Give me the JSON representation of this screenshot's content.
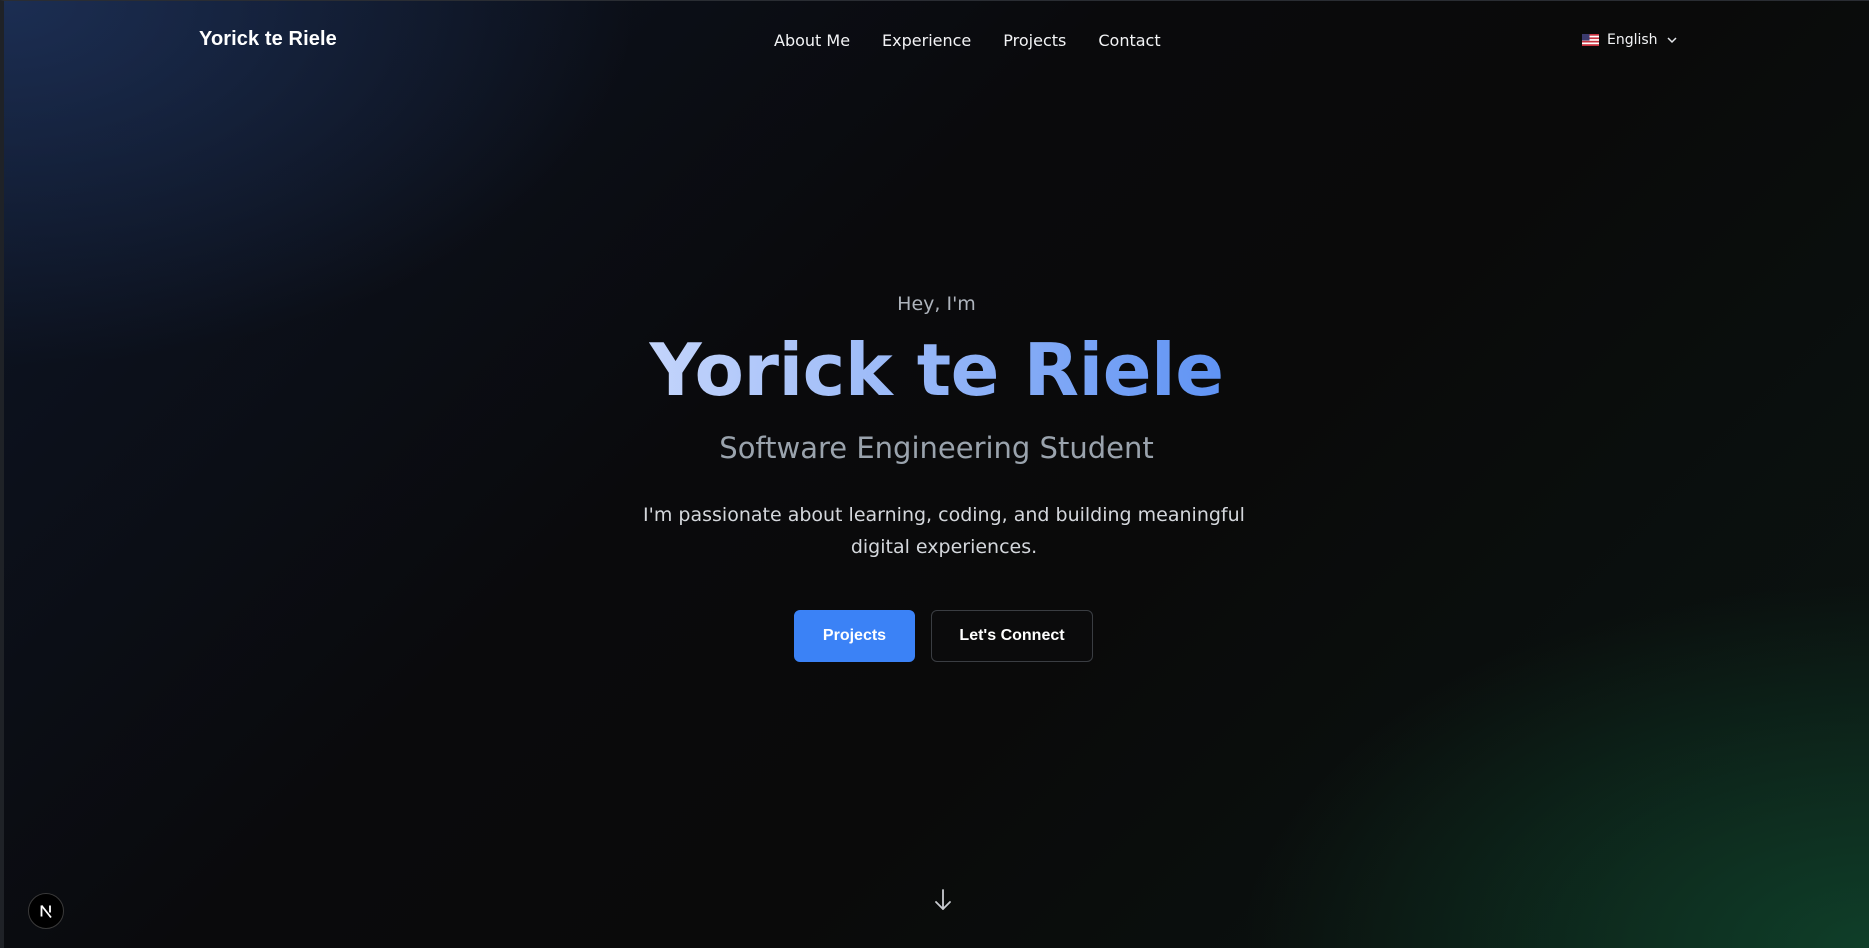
{
  "nav": {
    "brand": "Yorick te Riele",
    "links": [
      "About Me",
      "Experience",
      "Projects",
      "Contact"
    ],
    "language": {
      "label": "English",
      "flag_icon": "us-flag-icon"
    }
  },
  "hero": {
    "greeting": "Hey, I'm",
    "name": "Yorick te Riele",
    "subtitle": "Software Engineering Student",
    "description": "I'm passionate about learning, coding, and building meaningful digital experiences.",
    "primary_button": "Projects",
    "secondary_button": "Let's Connect",
    "scroll_icon": "arrow-down-icon"
  },
  "dev_badge": {
    "icon": "nextjs-icon"
  },
  "colors": {
    "accent": "#3b82f6",
    "name_gradient_start": "#c3d4fb",
    "name_gradient_end": "#5f93f4"
  }
}
